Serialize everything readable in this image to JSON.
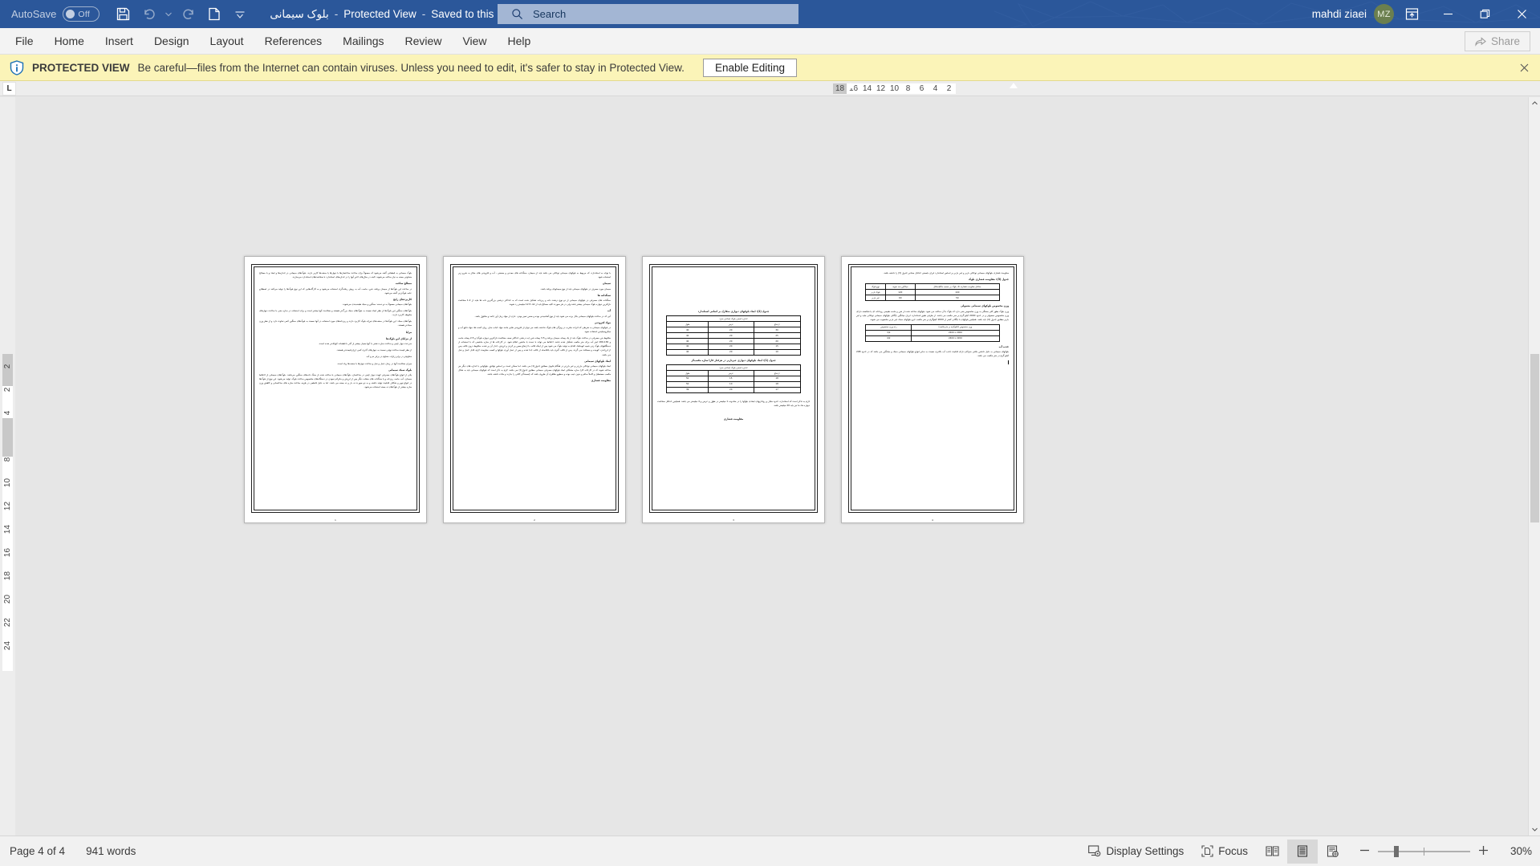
{
  "titlebar": {
    "autosave_label": "AutoSave",
    "autosave_state": "Off",
    "doc_title": "بلوک سیمانی",
    "sep1": "-",
    "protected_view": "Protected View",
    "sep2": "-",
    "saved_state": "Saved to this PC",
    "user_name": "mahdi ziaei",
    "avatar_initials": "MZ",
    "icons": {
      "save": "save-icon",
      "undo": "undo-icon",
      "redo": "redo-icon",
      "new_doc": "new-document-icon",
      "customize": "customize-quick-access-icon",
      "title_dropdown": "chevron-down-icon",
      "ribbon_display": "ribbon-display-options-icon",
      "minimize": "minimize-icon",
      "restore": "restore-icon",
      "close": "close-icon"
    }
  },
  "search": {
    "placeholder": "Search",
    "value": "",
    "icon": "search-icon"
  },
  "ribbon": {
    "tabs": [
      {
        "label": "File"
      },
      {
        "label": "Home"
      },
      {
        "label": "Insert"
      },
      {
        "label": "Design"
      },
      {
        "label": "Layout"
      },
      {
        "label": "References"
      },
      {
        "label": "Mailings"
      },
      {
        "label": "Review"
      },
      {
        "label": "View"
      },
      {
        "label": "Help"
      }
    ],
    "share_label": "Share",
    "share_icon": "share-icon"
  },
  "protected_view": {
    "icon": "info-shield-icon",
    "label": "PROTECTED VIEW",
    "message": "Be careful—files from the Internet can contain viruses. Unless you need to edit, it's safer to stay in Protected View.",
    "button_label": "Enable Editing",
    "close_icon": "close-icon"
  },
  "ruler": {
    "tab_stop_marker": "L",
    "horizontal_ticks": [
      "18",
      "16",
      "14",
      "12",
      "10",
      "8",
      "6",
      "4",
      "2"
    ],
    "vertical_ticks": [
      "2",
      "2",
      "4",
      "6",
      "8",
      "10",
      "12",
      "14",
      "16",
      "18",
      "20",
      "22",
      "24"
    ]
  },
  "statusbar": {
    "page_info": "Page 4 of 4",
    "word_count": "941 words",
    "display_settings": "Display Settings",
    "display_settings_icon": "display-settings-icon",
    "focus": "Focus",
    "focus_icon": "focus-mode-icon",
    "view_read_icon": "read-mode-icon",
    "view_print_icon": "print-layout-icon",
    "view_web_icon": "web-layout-icon",
    "zoom_out_icon": "zoom-out-icon",
    "zoom_in_icon": "zoom-in-icon",
    "zoom_level": "30%"
  },
  "document": {
    "pages": [
      {
        "number": "1",
        "blocks": [
          {
            "type": "p",
            "text": "بلوک سیمانی به قطعاتی گفته می‌شود که معمولاً برای ساخت ساختمان‌ها با دیوارها یا سقف‌ها کاربر دارند. بلوک‌های سیمانی در اندازه‌ها و ابعاد و با مصالح متفاوتی بسته به نیاز ساخته می‌شوند. البته در سال‌های اخیر آنها را در اندازه‌های استاندارد با ضخامت‌های استاندارد می‌سازند."
          },
          {
            "type": "h",
            "text": "مصالح ساخت"
          },
          {
            "type": "p",
            "text": "در ساخت این بلوک‌ها از سیمان پرتلند، شن، ماسه، آب به روش ریخته‌گری استفاده می‌شود و به کارگاه‌هایی که این نوع بلوک‌ها را تولید می‌کنند در اصطلاح عامه بلوک‌زنی گفته می‌شود."
          },
          {
            "type": "h",
            "text": "کاربردهای رایج"
          },
          {
            "type": "p",
            "text": "بلوک‌های سیمانی معمولاً به دو دسته: سنگین و سبک طبقه‌بندی می‌شوند."
          },
          {
            "type": "p",
            "text": "بلوک‌های سنگین این بلوک‌ها از نظر ابعاد نسبت به بلوک‌های سبک بزرگ‌تر هستند و ضخامت آنها بیشتر است و برای استفاده در سازه بتنی با ساخت دیوارهای محوطه کاربرد دارند."
          },
          {
            "type": "p",
            "text": "بلوک‌های سبک: این بلوک‌ها در سقف‌های تیرچه بلوک کاربرد دارند و ریزدانه‌های مورد استفاده در آنها نسبت به بلوک‌های سنگین کمی تفاوت دارد و از نظر وزن سبک‌تر هستند."
          },
          {
            "type": "h",
            "text": "مزایا"
          },
          {
            "type": "h",
            "text": "از مزایای این بلوک‌ها"
          },
          {
            "type": "p",
            "text": "سرعت دیوار چینی و ساخت سازه دشتی با آنها بسیار بیشتر از آجر با قطعات کوچک‌تر شده است."
          },
          {
            "type": "p",
            "text": "از نظر قیمت ساخت نهایی نسبت به دیوارهای آجری کمی ارزان‌قیمت‌تر هستند."
          },
          {
            "type": "p",
            "text": "مقاوم‌تر در برابر زلزله، مقاوم در برابر نم و آب."
          },
          {
            "type": "p",
            "text": "میزان ضخامت آنها در زمان عمل و نقل و ساخت دیوارها با سقف‌ها زیاد است."
          },
          {
            "type": "h",
            "text": "بلوک سبک سیمانی"
          },
          {
            "type": "p",
            "text": "یکی از انواع بلوک‌های مصرفی جهت دیوار چینی در ساختمان، بلوک‌های سیمانی یا ساخته شده از سنگ دانه‌های سنگین می‌باشد. بلوک‌های سیمانی از اختلاط سیمان، آب، ماسه ریزدانه و یا سنگدانه های مشابه دیگر پس از لرزش و ماترکم نمودن در دستگاه‌های مخصوص ساخت بلوک، تولید می‌شود. این نوع از بلوک‌ها در انواع توپر و شکاف قابلیت تولید داشته و به دو صورت ته بار و ته بسته می باشد. اما به دلیل قاطعی در هزینه ساخت سازه های ساختمانی و کاهش وزن سازه بیشتر از بلوک‌های ته بسته استفاده می‌شود."
          }
        ],
        "tables": []
      },
      {
        "number": "2",
        "blocks": [
          {
            "type": "p",
            "text": "با توجه به استاندارد، که مربوط به بلوکهای سیمانی توخالی می باشد باید از سیمان، سنگدانه های معدنی و صنعتی ، آب و افزودنی های مجاز به شرح زیر استفاده شود."
          },
          {
            "type": "h",
            "text": "سیمان"
          },
          {
            "type": "p",
            "text": "سیمان مورد مصرف در بلوکهای سیمانی باید از نوع سیمانهای پرتلند باشد."
          },
          {
            "type": "h",
            "text": "سنگدانه ها"
          },
          {
            "type": "p",
            "text": "سنگدانه های مصرفی در بلوکهای سیمانی از دو نوع درشت دانه و ریزدانه تشکیل شده است که به حداکثر درشتی بزرگترین دانه ها نباید از 1.2 ضخامت نازکترین دیواره بلوک سیمانی بیشتر باشد ولی در هر صورت کلیه مصالح باید از اتک 12.5 میلیمتر رد شوند."
          },
          {
            "type": "h",
            "text": "آب"
          },
          {
            "type": "p",
            "text": "آبی که در ساخت بلوکهای سیمانی بکار برده می شود باید از نوع آشامیدنی بوده و ضمن تمیز بودن، عاری از مواد زیان آور جامد و محلول باشد."
          },
          {
            "type": "h",
            "text": "مواد افزودنی"
          },
          {
            "type": "p",
            "text": "در بلوکهای سیمانی به شرطی که اثرات مخرب در ویژگی های بلوک نداشته باشد می توان از افزودنی هایی مانند مواد حباب ساز، روان کننده ها، مواد دافع آب و میکروسیلیس استفاده نمود."
          },
          {
            "type": "p",
            "text": "مخلوط بتن مصرفی در ساخت بلوک باید از یک پیمانه سیمان پرتلند و 3.5 پیمانه شن (به درشتی حداکثر نصف ضخامت نازکترین دیواره بلوک) و 2.5 پیمانه ماسه و 130-180 لیتر آب برای متر مکعب تشکیل شده باشد. اختلاط می تواند با دست یا ماشین انجام شود. در کارخانه ها از سازه ماشینی که با استفاده از دستگاههای بلوک زنی شبیه اتوماتیک اقدام به تولید بلوک می شود پس از اینکه قالب با ارتفاع معین پر کردن و لرزش، جدار آن پر شده، مخلوط درون قالب پس از لرزاندن، کوبیده و مسافت می گردد. پس از قالب گیری باید بلافاصله از قالب جدا شده و پس از عمل آوری بلوکها و کسب مقاومت لازم، قابل حمل و نقل می باشد."
          },
          {
            "type": "h",
            "text": "ابعاد بلوکهای سیمانی"
          },
          {
            "type": "p",
            "text": "ابعاد بلوکهای سیمانی توخالی بارزتر و غیر بارزتر در هنگام تحویل مطابق جدول(1) می باشد. اما ممکن است بر اساس توافق، بلوکهایی با اندازه های دیگر نیز ساخته شوند که در کارخانه کارا سازه مشکلی ابعاد بلوکهای مصرفی سیمانی مطابق جدول(1) می باشد. لازم به ذکر است که بلوکهای سیمانی باید به شکل مکعب مستطیل و کاملاً سالم و بدون عیب بوده و سطوح ظاهری آن ظروی باشد که چسبندگی کافی را بدارند و ملات داشته باشد."
          },
          {
            "type": "h",
            "text": "مقاومت فشاری"
          }
        ],
        "tables": []
      },
      {
        "number": "3",
        "blocks": [],
        "tables": [
          {
            "caption": "جدول (1): ابعاد بلوکهای دیواری متکازل بر اساس استاندارد",
            "header_span": "اندازه اسمی بلوک (سانتی متر)",
            "columns": [
              "ارتفاع",
              "عرض",
              "طول"
            ],
            "rows": [
              [
                "30",
                "20",
                "40"
              ],
              [
                "25",
                "20",
                "40"
              ],
              [
                "20",
                "20",
                "40"
              ],
              [
                "15",
                "20",
                "40"
              ],
              [
                "10",
                "20",
                "40"
              ]
            ]
          },
          {
            "caption": "جدول (1): ابعاد بلوکهای دیواری غیرباربر در هرکنار کارا سازه مکعب‌گر",
            "header_span": "اندازه اسمی بلوک (سانتی متر)",
            "columns": [
              "ارتفاع",
              "عرض",
              "طول"
            ],
            "rows": [
              [
                "18",
                "15",
                "50"
              ],
              [
                "18",
                "10",
                "50"
              ],
              [
                "17",
                "20",
                "39"
              ]
            ]
          }
        ],
        "footnote": "لازم به تذکر است که استاندارد، حدود مجاز و رواداریهای ابعادی بلوکها را در محدوده 1 میلیمتر در طول و عرض و 4 میلیمتر می باشد. همچنین حداقل ضخامت دیواره ها، ما تیز باید 20 میلیمتر باشد.",
        "heading_end": "مقاومت فشاری"
      },
      {
        "number": "4",
        "blocks": [
          {
            "type": "p",
            "text": "مقاومت فشاری بلوکهای سیمانی توخالی باربر و غیر باربر بر اساس استاندارد ایران بایستی حداقل مقادیر جدول (3) را داشته باشد."
          },
          {
            "type": "h",
            "text": "جدول (3): مقاومت فشاری بلوک"
          }
        ],
        "tables": [
          {
            "caption": "",
            "columns": [
              "حداقل مقاومت فشاری تک بلوک بر حسب مگاپاسکال",
              "میانگین سه نمونه"
            ],
            "rowheader": "نوع بلوک",
            "rows": [
              [
                "100",
                "120",
                "بلوک باربر"
              ],
              [
                "50",
                "60",
                "غیر باربر"
              ]
            ]
          },
          {
            "caption": "",
            "columns": [
              "وزن مخصوص (کیلوگرم بر مترمکعب)",
              "رده وزن مخصوص"
            ],
            "rows": [
              [
                "2000 تا 2200",
                "3/2"
              ],
              [
                "2200 تا 2400",
                "4/2"
              ]
            ]
          }
        ],
        "extra_blocks": [
          {
            "type": "h",
            "text": "وزن مخصوص بلوکهای سیمانی معمولی"
          },
          {
            "type": "p",
            "text": "وزن بلوک بطور کلی بستگی به وزن مخصوص بتنی دارد که بلوک با آن ساخته می شود. بلوکهای ساخته شده از شن و ماسه طبیعی رودخانه ای یا شکسته دارای وزن مخصوص معمولی و در حدود 2000 کیلو گرم بر متر مکعب می باشد. از طرفی طبق استاندارد، ایران میانگین چگالی بلوکهای سیمانی توخالی نباید و غیر باربر مطابق جدول (4) باید باشد. همچنین بلوکهای با چگالی کمتر از 2000 کیلوگرم بر متر مکعب جزو بلوکهای سبک غیر باربر محسوب می شوند."
          },
          {
            "type": "h",
            "text": "جذب آب"
          },
          {
            "type": "p",
            "text": "بلوکهای سیمانی به دلیل داشتن بافتی متراکم دارای قابلیت جذب آب بالاتری نسبت به سایر انواع بلوکهای سیمانی سبک و میانگین می باشد که در حدود 208 کیلو گرم در متر مکعب می باشد."
          }
        ]
      }
    ]
  }
}
